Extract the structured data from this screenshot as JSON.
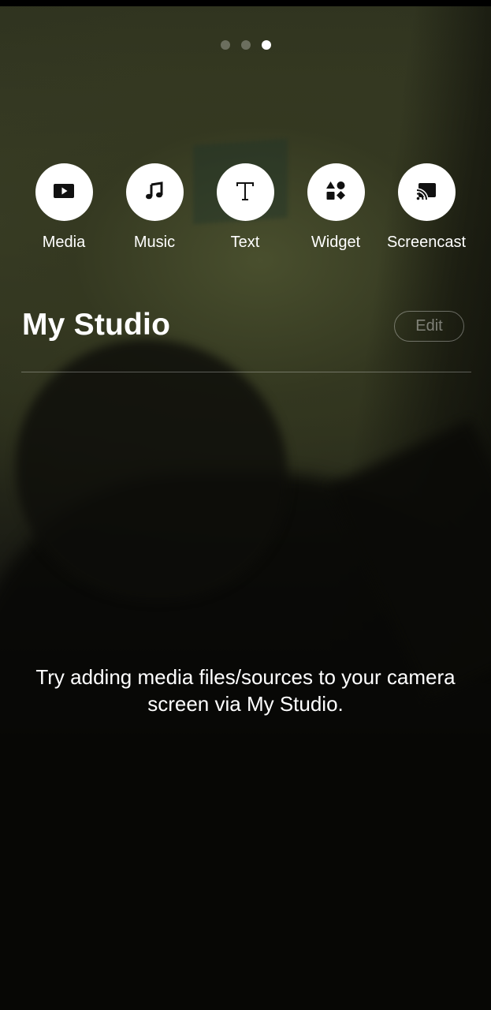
{
  "pager": {
    "pages": 3,
    "active_index": 2
  },
  "shortcuts": [
    {
      "label": "Media",
      "icon": "play-box-icon"
    },
    {
      "label": "Music",
      "icon": "music-note-icon"
    },
    {
      "label": "Text",
      "icon": "text-t-icon"
    },
    {
      "label": "Widget",
      "icon": "shapes-icon"
    },
    {
      "label": "Screencast",
      "icon": "cast-icon"
    }
  ],
  "studio": {
    "title": "My Studio",
    "edit_label": "Edit",
    "empty_message": "Try adding media files/sources to your camera screen via My Studio."
  },
  "colors": {
    "icon_circle": "#ffffff",
    "icon_glyph": "#111111",
    "text": "#ffffff",
    "inactive_dot": "#5a5a5a"
  }
}
